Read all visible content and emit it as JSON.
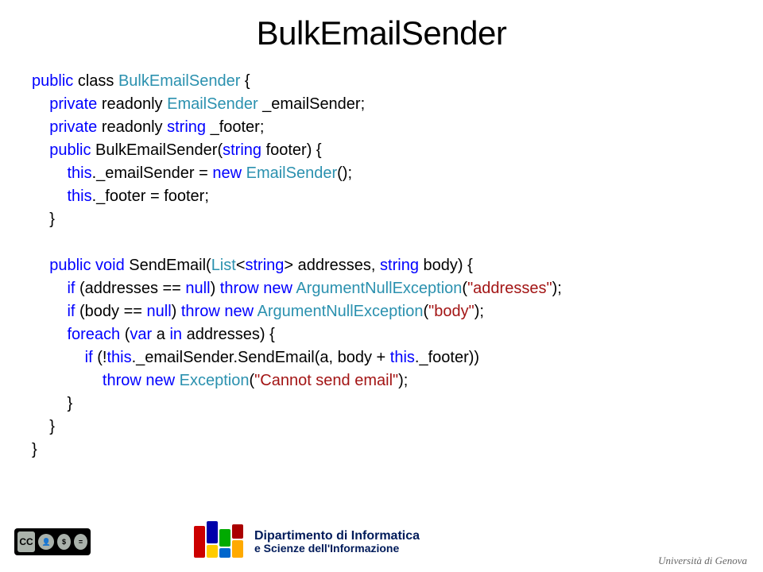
{
  "title": "BulkEmailSender",
  "code": {
    "l1a": "public",
    "l1b": " class ",
    "l1c": "BulkEmailSender",
    "l1d": " {",
    "l2a": "    private",
    "l2b": " readonly ",
    "l2c": "EmailSender",
    "l2d": " _emailSender;",
    "l3a": "    private",
    "l3b": " readonly ",
    "l3c": "string",
    "l3d": " _footer;",
    "l4a": "    public",
    "l4b": " BulkEmailSender(",
    "l4c": "string",
    "l4d": " footer) {",
    "l5a": "        this",
    "l5b": "._emailSender = ",
    "l5c": "new",
    "l5d": " ",
    "l5e": "EmailSender",
    "l5f": "();",
    "l6a": "        this",
    "l6b": "._footer = footer;",
    "l7": "    }",
    "l8": "",
    "l9a": "    public",
    "l9b": " ",
    "l9c": "void",
    "l9d": " SendEmail(",
    "l9e": "List",
    "l9f": "<",
    "l9g": "string",
    "l9h": "> addresses, ",
    "l9i": "string",
    "l9j": " body) {",
    "l10a": "        if",
    "l10b": " (addresses == ",
    "l10c": "null",
    "l10d": ") ",
    "l10e": "throw",
    "l10f": " ",
    "l10g": "new",
    "l10h": " ",
    "l10i": "ArgumentNullException",
    "l10j": "(",
    "l10k": "\"addresses\"",
    "l10l": ");",
    "l11a": "        if",
    "l11b": " (body == ",
    "l11c": "null",
    "l11d": ") ",
    "l11e": "throw",
    "l11f": " ",
    "l11g": "new",
    "l11h": " ",
    "l11i": "ArgumentNullException",
    "l11j": "(",
    "l11k": "\"body\"",
    "l11l": ");",
    "l12a": "        foreach",
    "l12b": " (",
    "l12c": "var",
    "l12d": " a ",
    "l12e": "in",
    "l12f": " addresses) {",
    "l13a": "            if",
    "l13b": " (!",
    "l13c": "this",
    "l13d": "._emailSender.SendEmail(a, body + ",
    "l13e": "this",
    "l13f": "._footer))",
    "l14a": "                throw",
    "l14b": " ",
    "l14c": "new",
    "l14d": " ",
    "l14e": "Exception",
    "l14f": "(",
    "l14g": "\"Cannot send email\"",
    "l14h": ");",
    "l15": "        }",
    "l16": "    }",
    "l17": "}"
  },
  "footer": {
    "cc_by": "BY",
    "cc_nc": "NC",
    "cc_nd": "ND",
    "disi_line1": "Dipartimento di Informatica",
    "disi_line2": "e Scienze dell'Informazione",
    "unige": "Università di Genova"
  }
}
